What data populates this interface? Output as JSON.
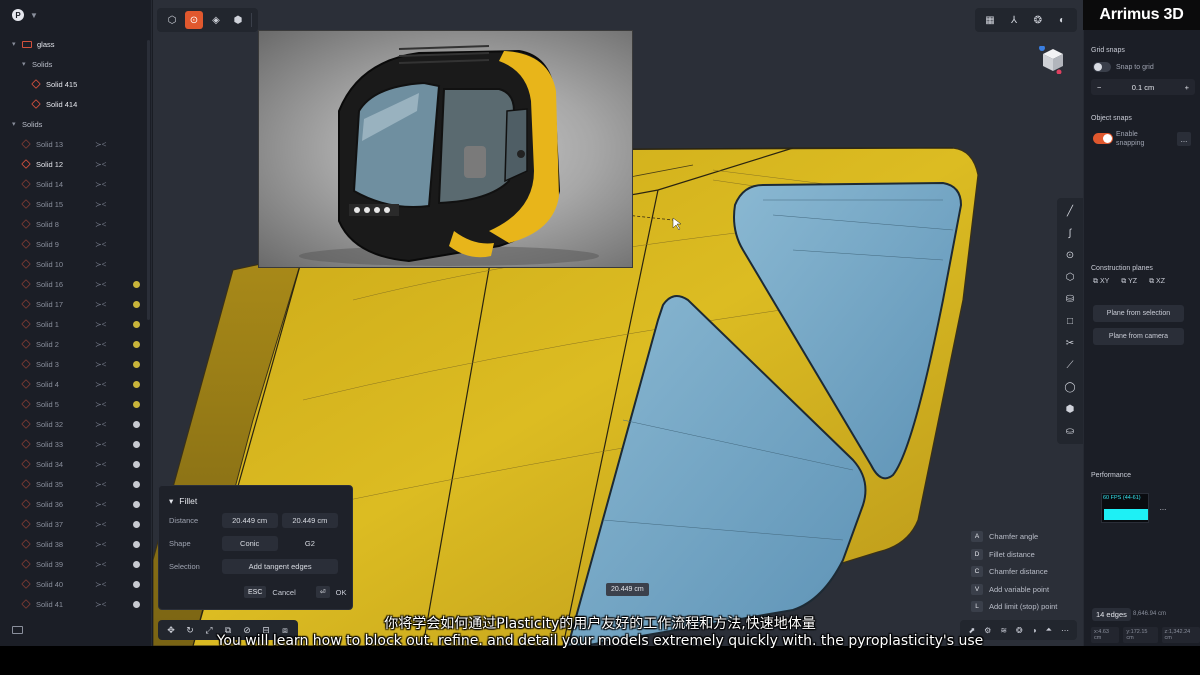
{
  "brand": "Arrimus 3D",
  "sidebar": {
    "logo_letter": "P",
    "tree": [
      {
        "label": "glass",
        "kind": "folder",
        "level": 0,
        "expanded": true,
        "bright": true
      },
      {
        "label": "Solids",
        "kind": "group",
        "level": 1,
        "expanded": true
      },
      {
        "label": "Solid 415",
        "kind": "solid",
        "level": 2,
        "bright": true
      },
      {
        "label": "Solid 414",
        "kind": "solid",
        "level": 2,
        "bright": true
      },
      {
        "label": "Solids",
        "kind": "group",
        "level": 0,
        "expanded": true
      },
      {
        "label": "Solid 13",
        "kind": "solid",
        "level": 1,
        "vis": true,
        "dot": ""
      },
      {
        "label": "Solid 12",
        "kind": "solid",
        "level": 1,
        "vis": true,
        "dot": "",
        "bright": true
      },
      {
        "label": "Solid 14",
        "kind": "solid",
        "level": 1,
        "vis": true,
        "dot": ""
      },
      {
        "label": "Solid 15",
        "kind": "solid",
        "level": 1,
        "vis": true,
        "dot": ""
      },
      {
        "label": "Solid 8",
        "kind": "solid",
        "level": 1,
        "vis": true,
        "dot": ""
      },
      {
        "label": "Solid 9",
        "kind": "solid",
        "level": 1,
        "vis": true,
        "dot": ""
      },
      {
        "label": "Solid 10",
        "kind": "solid",
        "level": 1,
        "vis": true,
        "dot": ""
      },
      {
        "label": "Solid 16",
        "kind": "solid",
        "level": 1,
        "vis": true,
        "dot": "#c9b43a"
      },
      {
        "label": "Solid 17",
        "kind": "solid",
        "level": 1,
        "vis": true,
        "dot": "#c9b43a"
      },
      {
        "label": "Solid 1",
        "kind": "solid",
        "level": 1,
        "vis": true,
        "dot": "#c9b43a"
      },
      {
        "label": "Solid 2",
        "kind": "solid",
        "level": 1,
        "vis": true,
        "dot": "#c9b43a"
      },
      {
        "label": "Solid 3",
        "kind": "solid",
        "level": 1,
        "vis": true,
        "dot": "#c9b43a"
      },
      {
        "label": "Solid 4",
        "kind": "solid",
        "level": 1,
        "vis": true,
        "dot": "#c9b43a"
      },
      {
        "label": "Solid 5",
        "kind": "solid",
        "level": 1,
        "vis": true,
        "dot": "#c9b43a"
      },
      {
        "label": "Solid 32",
        "kind": "solid",
        "level": 1,
        "vis": true,
        "dot": "#c7c9cf"
      },
      {
        "label": "Solid 33",
        "kind": "solid",
        "level": 1,
        "vis": true,
        "dot": "#c7c9cf"
      },
      {
        "label": "Solid 34",
        "kind": "solid",
        "level": 1,
        "vis": true,
        "dot": "#c7c9cf"
      },
      {
        "label": "Solid 35",
        "kind": "solid",
        "level": 1,
        "vis": true,
        "dot": "#c7c9cf"
      },
      {
        "label": "Solid 36",
        "kind": "solid",
        "level": 1,
        "vis": true,
        "dot": "#c7c9cf"
      },
      {
        "label": "Solid 37",
        "kind": "solid",
        "level": 1,
        "vis": true,
        "dot": "#c7c9cf"
      },
      {
        "label": "Solid 38",
        "kind": "solid",
        "level": 1,
        "vis": true,
        "dot": "#c7c9cf"
      },
      {
        "label": "Solid 39",
        "kind": "solid",
        "level": 1,
        "vis": true,
        "dot": "#c7c9cf"
      },
      {
        "label": "Solid 40",
        "kind": "solid",
        "level": 1,
        "vis": true,
        "dot": "#c7c9cf"
      },
      {
        "label": "Solid 41",
        "kind": "solid",
        "level": 1,
        "vis": true,
        "dot": "#c7c9cf"
      }
    ]
  },
  "fillet": {
    "title": "Fillet",
    "distance_label": "Distance",
    "distance_1": "20.449 cm",
    "distance_2": "20.449 cm",
    "shape_label": "Shape",
    "shape_value": "Conic",
    "shape_alt": "G2",
    "selection_label": "Selection",
    "selection_button": "Add tangent edges",
    "esc_key": "ESC",
    "cancel": "Cancel",
    "ok": "OK"
  },
  "dimension_tag": "20.449 cm",
  "hints": [
    {
      "key": "A",
      "label": "Chamfer angle"
    },
    {
      "key": "D",
      "label": "Fillet distance"
    },
    {
      "key": "C",
      "label": "Chamfer distance"
    },
    {
      "key": "V",
      "label": "Add variable point"
    },
    {
      "key": "L",
      "label": "Add limit (stop) point"
    }
  ],
  "right_panel": {
    "grid_snaps": "Grid snaps",
    "snap_to_grid": "Snap to grid",
    "grid_value": "0.1 cm",
    "minus": "−",
    "plus": "+",
    "object_snaps": "Object snaps",
    "enable_snapping": "Enable snapping",
    "construction_planes": "Construction planes",
    "plane_xy": "XY",
    "plane_yz": "YZ",
    "plane_xz": "XZ",
    "plane_from_selection": "Plane from selection",
    "plane_from_camera": "Plane from camera",
    "performance": "Performance",
    "fps": "60 FPS (44-61)",
    "edges": "14 edges",
    "edges_value": "8,646.94 cm",
    "coord_x": "x:4.63 cm",
    "coord_y": "y:172.15 cm",
    "coord_z": "z:1,342.24 cm",
    "more": "..."
  },
  "subtitles": {
    "cn": "你将学会如何通过Plasticity的用户友好的工作流程和方法,快速地体量",
    "en": "You will learn how to block out. refine. and detail your models extremely quickly with. the pyroplasticity's use"
  },
  "colors": {
    "accent": "#e0582e",
    "model_yellow": "#d9b820",
    "glass_blue": "#6fa3c2"
  }
}
